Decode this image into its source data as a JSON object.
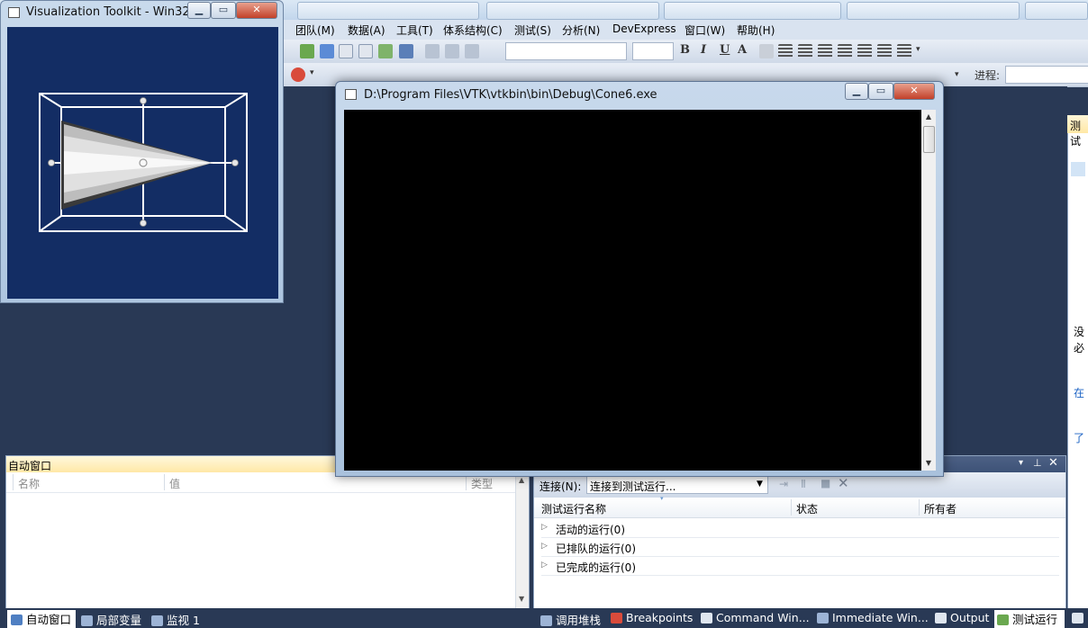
{
  "menubar": {
    "items": [
      "团队(M)",
      "数据(A)",
      "工具(T)",
      "体系结构(C)",
      "测试(S)",
      "分析(N)",
      "DevExpress",
      "窗口(W)",
      "帮助(H)"
    ]
  },
  "toolbar2": {
    "progress_label": "进程:"
  },
  "vtk_window": {
    "title": "Visualization Toolkit - Win32..."
  },
  "console_window": {
    "title": "D:\\Program Files\\VTK\\vtkbin\\bin\\Debug\\Cone6.exe"
  },
  "auto_window": {
    "title": "自动窗口",
    "columns": [
      "名称",
      "值",
      "类型"
    ]
  },
  "test_runs": {
    "connect_label": "连接(N):",
    "connect_value": "连接到测试运行...",
    "columns": [
      "测试运行名称",
      "状态",
      "所有者"
    ],
    "rows": [
      "活动的运行(0)",
      "已排队的运行(0)",
      "已完成的运行(0)"
    ]
  },
  "right_panel": {
    "header": "测试",
    "text_1": "没",
    "text_2": "必",
    "link_1": "在",
    "link_2": "了"
  },
  "bottom_tabs": {
    "left": [
      "自动窗口",
      "局部变量",
      "监视 1"
    ],
    "right": [
      "调用堆栈",
      "Breakpoints",
      "Command Win...",
      "Immediate Win...",
      "Output",
      "测试运行"
    ]
  },
  "colors": {
    "ide_background": "#293955",
    "vtk_canvas": "#132d64",
    "console_background": "#000000"
  },
  "icons": [
    "minimize-icon",
    "maximize-icon",
    "close-icon",
    "console-app-icon",
    "vtk-app-icon",
    "pin-icon",
    "dropdown-icon",
    "expand-arrow-icon"
  ]
}
